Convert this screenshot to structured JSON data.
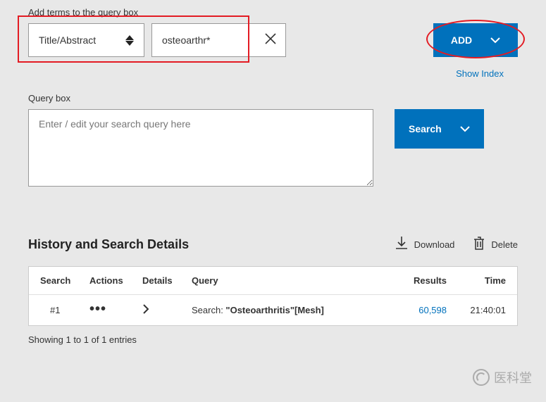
{
  "add_terms": {
    "label": "Add terms to the query box",
    "field_select": "Title/Abstract",
    "term_value": "osteoarthr*",
    "add_button": "ADD",
    "show_index": "Show Index"
  },
  "query_box": {
    "label": "Query box",
    "placeholder": "Enter / edit your search query here",
    "search_button": "Search"
  },
  "history": {
    "title": "History and Search Details",
    "download_label": "Download",
    "delete_label": "Delete",
    "columns": {
      "search": "Search",
      "actions": "Actions",
      "details": "Details",
      "query": "Query",
      "results": "Results",
      "time": "Time"
    },
    "rows": [
      {
        "search": "#1",
        "query_prefix": "Search: ",
        "query_bold": "\"Osteoarthritis\"[Mesh]",
        "results": "60,598",
        "time": "21:40:01"
      }
    ],
    "showing": "Showing 1 to 1 of 1 entries"
  },
  "watermark": "医科堂"
}
